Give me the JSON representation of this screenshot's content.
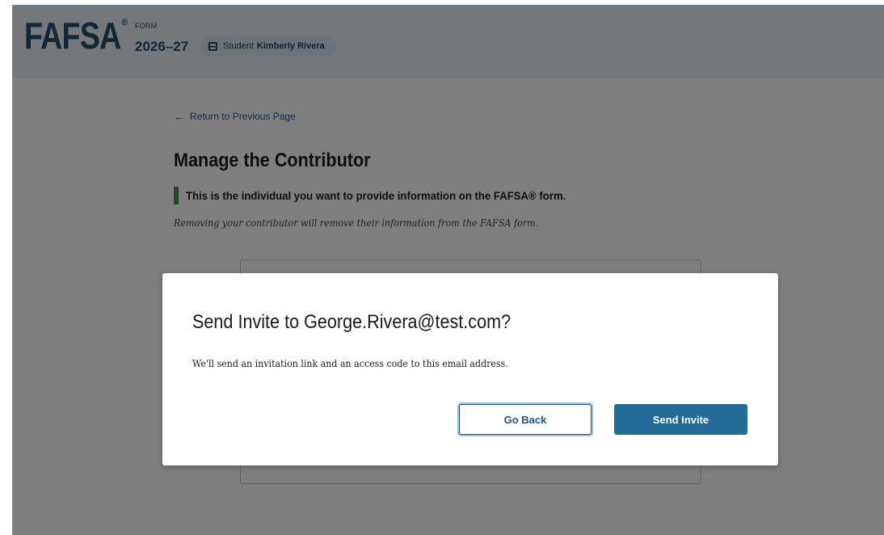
{
  "header": {
    "logo_text": "FAFSA",
    "logo_reg": "®",
    "form_label": "FORM",
    "form_year": "2026–27",
    "student_prefix": "Student",
    "student_name": "Kimberly Rivera"
  },
  "page": {
    "back_link": "Return to Previous Page",
    "title": "Manage the Contributor",
    "callout": "This is the individual you want to provide information on the FAFSA® form.",
    "subtext": "Removing your contributor will remove their information from the FAFSA form."
  },
  "modal": {
    "title": "Send Invite to George.Rivera@test.com?",
    "body": "We'll send an invitation link and an access code to this email address.",
    "go_back_label": "Go Back",
    "send_invite_label": "Send Invite"
  },
  "colors": {
    "brand_navy": "#1f4e6d",
    "primary_button": "#246c98",
    "callout_green": "#4c8f4a",
    "header_bg": "#e8f1f6"
  }
}
